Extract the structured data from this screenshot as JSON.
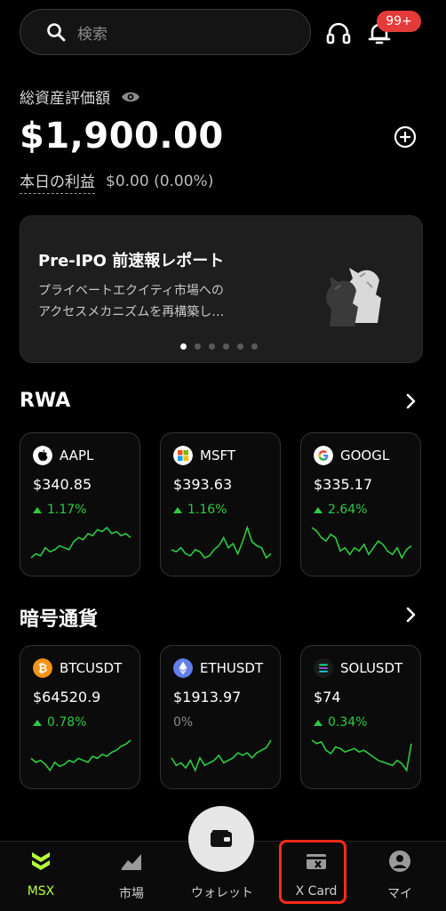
{
  "search": {
    "placeholder": "検索"
  },
  "header": {
    "notification_badge": "99+"
  },
  "assets": {
    "label": "総資産評価額",
    "balance": "$1,900.00",
    "profit_label": "本日の利益",
    "profit_value": "$0.00 (0.00%)"
  },
  "banner": {
    "title": "Pre-IPO 前速報レポート",
    "description": "プライベートエクイティ市場への\nアクセスメカニズムを再構築し…",
    "pages": 6,
    "active_page": 1
  },
  "rwa": {
    "title": "RWA",
    "cards": [
      {
        "symbol": "AAPL",
        "price": "$340.85",
        "change": "1.17%",
        "direction": "up",
        "icon": "apple-icon",
        "spark": [
          30,
          32,
          31,
          35,
          33,
          34,
          36,
          35,
          34,
          38,
          40,
          39,
          42,
          41,
          44,
          43,
          45,
          42,
          43,
          41,
          42,
          40
        ]
      },
      {
        "symbol": "MSFT",
        "price": "$393.63",
        "change": "1.16%",
        "direction": "up",
        "icon": "microsoft-icon",
        "spark": [
          36,
          35,
          37,
          34,
          33,
          36,
          35,
          32,
          33,
          36,
          38,
          42,
          37,
          39,
          34,
          40,
          47,
          40,
          38,
          37,
          32,
          34
        ]
      },
      {
        "symbol": "GOOGL",
        "price": "$335.17",
        "change": "2.64%",
        "direction": "up",
        "icon": "google-icon",
        "spark": [
          46,
          44,
          40,
          38,
          42,
          40,
          32,
          34,
          30,
          34,
          32,
          36,
          30,
          34,
          38,
          36,
          32,
          30,
          34,
          28,
          33,
          35
        ]
      }
    ]
  },
  "crypto": {
    "title": "暗号通貨",
    "cards": [
      {
        "symbol": "BTCUSDT",
        "price": "$64520.9",
        "change": "0.78%",
        "direction": "up",
        "icon": "bitcoin-icon",
        "spark": [
          36,
          34,
          35,
          33,
          30,
          34,
          32,
          33,
          35,
          34,
          36,
          35,
          34,
          37,
          36,
          38,
          37,
          39,
          40,
          42,
          43,
          45
        ]
      },
      {
        "symbol": "ETHUSDT",
        "price": "$1913.97",
        "change": "0%",
        "direction": "flat",
        "icon": "ethereum-icon",
        "spark": [
          36,
          33,
          34,
          32,
          35,
          31,
          36,
          33,
          34,
          35,
          37,
          34,
          35,
          36,
          38,
          37,
          38,
          36,
          38,
          39,
          40,
          43
        ]
      },
      {
        "symbol": "SOLUSDT",
        "price": "$74",
        "change": "0.34%",
        "direction": "up",
        "icon": "solana-icon",
        "spark": [
          46,
          44,
          45,
          40,
          38,
          42,
          41,
          39,
          40,
          41,
          39,
          40,
          38,
          36,
          34,
          33,
          32,
          31,
          34,
          32,
          28,
          44
        ]
      }
    ]
  },
  "nav": {
    "items": [
      {
        "label": "MSX",
        "icon": "msx-logo-icon",
        "active": true
      },
      {
        "label": "市場",
        "icon": "chart-icon",
        "active": false
      },
      {
        "label": "ウォレット",
        "icon": "wallet-icon",
        "active": false
      },
      {
        "label": "X Card",
        "icon": "x-card-icon",
        "active": false
      },
      {
        "label": "マイ",
        "icon": "user-icon",
        "active": false
      }
    ]
  },
  "colors": {
    "up": "#2ecc40",
    "flat": "#8a8a8a",
    "accent": "#b7ff3c",
    "badge": "#e53a3a",
    "highlight": "#ff2a1a"
  }
}
